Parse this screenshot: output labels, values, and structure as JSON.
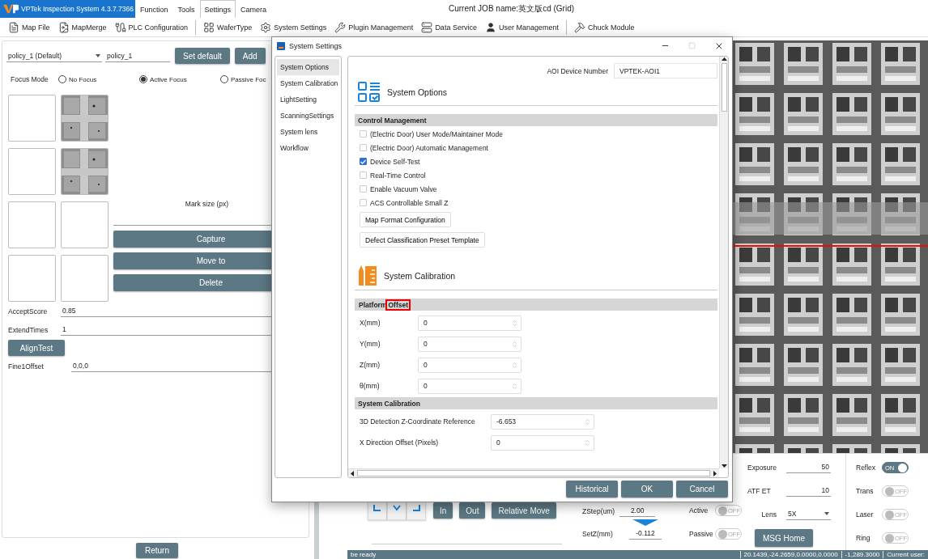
{
  "app": {
    "title": "VPTek Inspection System 4.3.7.7366"
  },
  "menu": [
    {
      "label": "Function",
      "selected": false
    },
    {
      "label": "Tools",
      "selected": false
    },
    {
      "label": "Settings",
      "selected": true
    },
    {
      "label": "Camera",
      "selected": false
    }
  ],
  "job": {
    "label": "Current JOB name:",
    "value": "英文版cd (Grid)"
  },
  "toolbar": [
    {
      "label": "Map File",
      "kind": "file",
      "separator_before": false
    },
    {
      "label": "MapMerge",
      "kind": "merge",
      "separator_before": false
    },
    {
      "label": "PLC Configuration",
      "kind": "plc",
      "separator_before": false
    },
    {
      "label": "WaferType",
      "kind": "grid",
      "separator_before": true
    },
    {
      "label": "System Settings",
      "kind": "gear",
      "separator_before": false
    },
    {
      "label": "Plugin Management",
      "kind": "tools",
      "separator_before": false
    },
    {
      "label": "Data Service",
      "kind": "server",
      "separator_before": false
    },
    {
      "label": "User Management",
      "kind": "user",
      "separator_before": false
    },
    {
      "label": "Chuck Module",
      "kind": "hammer",
      "separator_before": true
    }
  ],
  "left_panel": {
    "policy_select": "policy_1 (Default)",
    "policy_name": "policy_1",
    "buttons": [
      "Set default",
      "Add"
    ],
    "focus": {
      "label": "Focus Mode",
      "options": [
        {
          "label": "No Focus",
          "selected": false
        },
        {
          "label": "Active Focus",
          "selected": true
        },
        {
          "label": "Passive Foc",
          "selected": false
        }
      ]
    },
    "marks": [
      {
        "kind": "empty"
      },
      {
        "kind": "picture"
      },
      {
        "kind": "empty"
      },
      {
        "kind": "picture"
      },
      {
        "kind": "empty"
      },
      {
        "kind": "empty"
      },
      {
        "kind": "empty"
      },
      {
        "kind": "empty"
      }
    ],
    "mark_size_label": "Mark size (px)",
    "actions": [
      "Capture",
      "Move to",
      "Delete"
    ],
    "fields": [
      {
        "label": "AcceptScore",
        "value": "0.85"
      },
      {
        "label": "ExtendTimes",
        "value": "1"
      }
    ],
    "align_button": "AlignTest",
    "offset": {
      "label": "Fine1Offset",
      "value": "0,0,0"
    }
  },
  "return_button": "Return",
  "dialog": {
    "title": "System Settings",
    "nav": [
      {
        "label": "System Options",
        "selected": true
      },
      {
        "label": "System Calibration",
        "selected": false
      },
      {
        "label": "LightSetting",
        "selected": false
      },
      {
        "label": "ScanningSettings",
        "selected": false
      },
      {
        "label": "System lens",
        "selected": false
      },
      {
        "label": "Workflow",
        "selected": false
      }
    ],
    "device": {
      "label": "AOI Device Number",
      "value": "VPTEK-AOI1"
    },
    "options_heading": "System Options",
    "control_management": {
      "title": "Control Management",
      "checks": [
        {
          "label": "(Electric Door) User Mode/Maintainer Mode",
          "checked": false
        },
        {
          "label": "(Electric Door) Automatic Management",
          "checked": false
        },
        {
          "label": "Device Self-Test",
          "checked": true
        },
        {
          "label": "Real-Time Control",
          "checked": false
        },
        {
          "label": "Enable Vacuum Valve",
          "checked": false
        },
        {
          "label": "ACS Controllable Small Z",
          "checked": false
        }
      ],
      "buttons": [
        "Map Format Configuration",
        "Defect Classification Preset Template"
      ]
    },
    "calibration_heading": "System Calibration",
    "platform_offset": {
      "title_parts": [
        {
          "text": "Platform",
          "highlighted": false
        },
        {
          "text": "Offset",
          "highlighted": true
        }
      ],
      "fields": [
        {
          "label": "X(mm)",
          "value": "0"
        },
        {
          "label": "Y(mm)",
          "value": "0"
        },
        {
          "label": "Z(mm)",
          "value": "0"
        },
        {
          "label": "θ(mm)",
          "value": "0"
        }
      ]
    },
    "system_calibration": {
      "title": "System Calibration",
      "fields": [
        {
          "label": "3D Detection Z-Coordinate Reference",
          "value": "-6.653"
        },
        {
          "label": "X Direction Offset (Pixels)",
          "value": "0"
        }
      ]
    },
    "buttons": [
      "Historical",
      "OK",
      "Cancel"
    ]
  },
  "control_panel": {
    "move_buttons": [
      "In",
      "Out",
      "Relative Move"
    ],
    "zstep": {
      "label": "ZStep(um)",
      "value": "2.00"
    },
    "setz": {
      "label": "SetZ(mm)",
      "value": "-0.112"
    },
    "focus_toggles": [
      {
        "label": "Active",
        "on": false,
        "text": "OFF"
      },
      {
        "label": "Passive",
        "on": false,
        "text": "OFF"
      }
    ],
    "camera": [
      {
        "label": "Exposure",
        "value": "50",
        "kind": "input"
      },
      {
        "label": "ATF ET",
        "value": "10",
        "kind": "input"
      },
      {
        "label": "Lens",
        "value": "5X",
        "kind": "select"
      }
    ],
    "msg_button": "MSG Home",
    "lights": [
      {
        "label": "Reflex",
        "on": true,
        "text": "ON"
      },
      {
        "label": "Trans",
        "on": false,
        "text": "OFF"
      },
      {
        "label": "Laser",
        "on": false,
        "text": "OFF"
      },
      {
        "label": "Ring",
        "on": false,
        "text": "OFF"
      }
    ]
  },
  "status": [
    "be ready",
    "20.1439,-24.2659,0.0000,0.0000",
    "-1,289.3000",
    "Current user:"
  ]
}
